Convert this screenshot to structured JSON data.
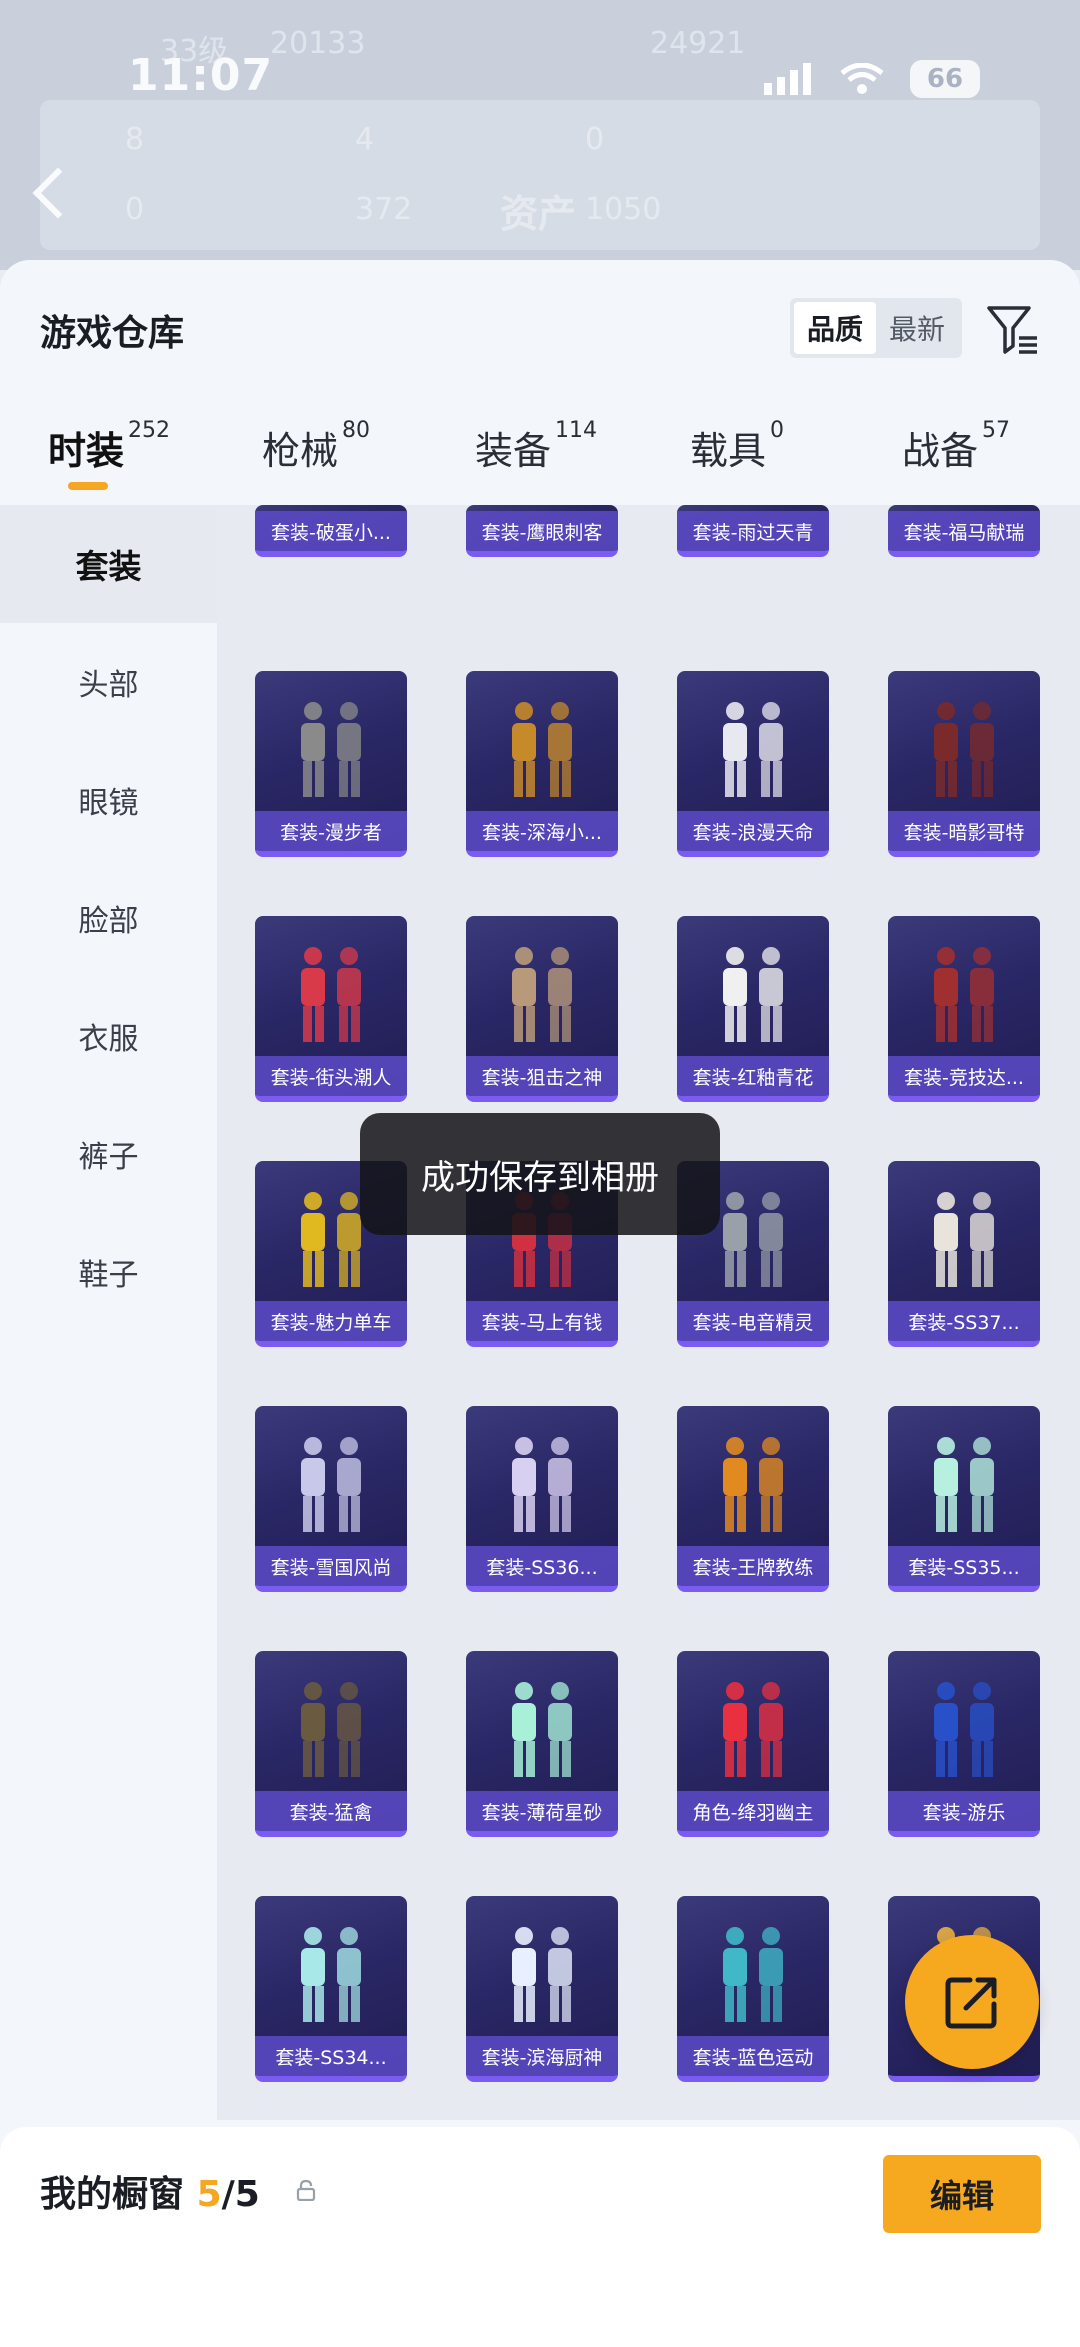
{
  "status_bar": {
    "time": "11:07",
    "battery": "66"
  },
  "background_header": {
    "level": "33级",
    "coins": "20133",
    "score": "24921",
    "asset_label": "资产",
    "stat1": "8",
    "stat2": "4",
    "stat3": "0",
    "stat4": "0",
    "stat5": "372",
    "stat6": "1050"
  },
  "sheet": {
    "title": "游戏仓库",
    "sort_options": [
      "品质",
      "最新"
    ],
    "sort_selected": "品质",
    "tabs": [
      {
        "label": "时装",
        "count": "252",
        "active": true
      },
      {
        "label": "枪械",
        "count": "80",
        "active": false
      },
      {
        "label": "装备",
        "count": "114",
        "active": false
      },
      {
        "label": "载具",
        "count": "0",
        "active": false
      },
      {
        "label": "战备",
        "count": "57",
        "active": false
      }
    ]
  },
  "categories": [
    "套装",
    "头部",
    "眼镜",
    "脸部",
    "衣服",
    "裤子",
    "鞋子"
  ],
  "category_selected": "套装",
  "items_partial_top": [
    "套装-破蛋小...",
    "套装-鹰眼刺客",
    "套装-雨过天青",
    "套装-福马献瑞"
  ],
  "items": [
    [
      "套装-漫步者",
      "套装-深海小...",
      "套装-浪漫天命",
      "套装-暗影哥特"
    ],
    [
      "套装-街头潮人",
      "套装-狙击之神",
      "套装-红釉青花",
      "套装-竞技达..."
    ],
    [
      "套装-魅力单车",
      "套装-马上有钱",
      "套装-电音精灵",
      "套装-SS37..."
    ],
    [
      "套装-雪国风尚",
      "套装-SS36...",
      "套装-王牌教练",
      "套装-SS35..."
    ],
    [
      "套装-猛禽",
      "套装-薄荷星砂",
      "角色-绛羽幽主",
      "套装-游乐"
    ],
    [
      "套装-SS34...",
      "套装-滨海厨神",
      "套装-蓝色运动",
      ""
    ]
  ],
  "toast": "成功保存到相册",
  "showcase": {
    "title": "我的橱窗",
    "current": "5",
    "total": "/5",
    "edit_label": "编辑"
  },
  "colors": {
    "accent": "#f5a623",
    "card_bg": "#2a2766",
    "card_label": "#5c4bc8"
  }
}
